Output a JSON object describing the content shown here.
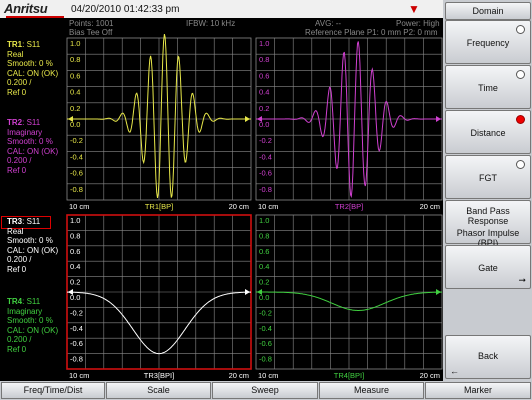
{
  "header": {
    "brand": "Anritsu",
    "datetime": "04/20/2010 01:42:33 pm",
    "points": "Points: 1001",
    "ifbw": "IFBW: 10 kHz",
    "avg": "AVG: --",
    "power": "Power: High",
    "bias_tee": "Bias Tee Off",
    "ref_plane": "Reference Plane P1: 0 mm P2: 0 mm",
    "status_icon": "antenna-icon"
  },
  "traces": [
    {
      "id": "TR1",
      "param": "S11",
      "format": "Real",
      "smooth": "Smooth: 0 %",
      "cal": "CAL: ON (OK)",
      "scale": "0.200 /",
      "ref": "Ref 0",
      "color": "#e8e84a",
      "plot_label": "TR1[BP]",
      "x_start": "10 cm",
      "x_end": "20 cm"
    },
    {
      "id": "TR2",
      "param": "S11",
      "format": "Imaginary",
      "smooth": "Smooth: 0 %",
      "cal": "CAL: ON (OK)",
      "scale": "0.200 /",
      "ref": "Ref 0",
      "color": "#d040d0",
      "plot_label": "TR2[BP]",
      "x_start": "10 cm",
      "x_end": "20 cm"
    },
    {
      "id": "TR3",
      "param": "S11",
      "format": "Real",
      "smooth": "Smooth: 0 %",
      "cal": "CAL: ON (OK)",
      "scale": "0.200 /",
      "ref": "Ref 0",
      "color": "#ffffff",
      "plot_label": "TR3[BPI]",
      "x_start": "10 cm",
      "x_end": "20 cm"
    },
    {
      "id": "TR4",
      "param": "S11",
      "format": "Imaginary",
      "smooth": "Smooth: 0 %",
      "cal": "CAL: ON (OK)",
      "scale": "0.200 /",
      "ref": "Ref 0",
      "color": "#40d040",
      "plot_label": "TR4[BPI]",
      "x_start": "10 cm",
      "x_end": "20 cm"
    }
  ],
  "y_ticks": [
    "1.0",
    "0.8",
    "0.6",
    "0.4",
    "0.2",
    "0.0",
    "-0.2",
    "-0.4",
    "-0.6",
    "-0.8"
  ],
  "sidebar": {
    "title": "Domain",
    "items": [
      {
        "label": "Frequency",
        "selected": false
      },
      {
        "label": "Time",
        "selected": false
      },
      {
        "label": "Distance",
        "selected": true
      },
      {
        "label": "FGT",
        "selected": false
      }
    ],
    "band_pass": "Band Pass Response",
    "phasor": "Phasor Impulse (BPI)",
    "gate": "Gate",
    "back": "Back"
  },
  "bottom_menu": [
    "Freq/Time/Dist",
    "Scale",
    "Sweep",
    "Measure",
    "Marker"
  ],
  "grid_color": "#8a8a8a",
  "active_color": "#d01010"
}
